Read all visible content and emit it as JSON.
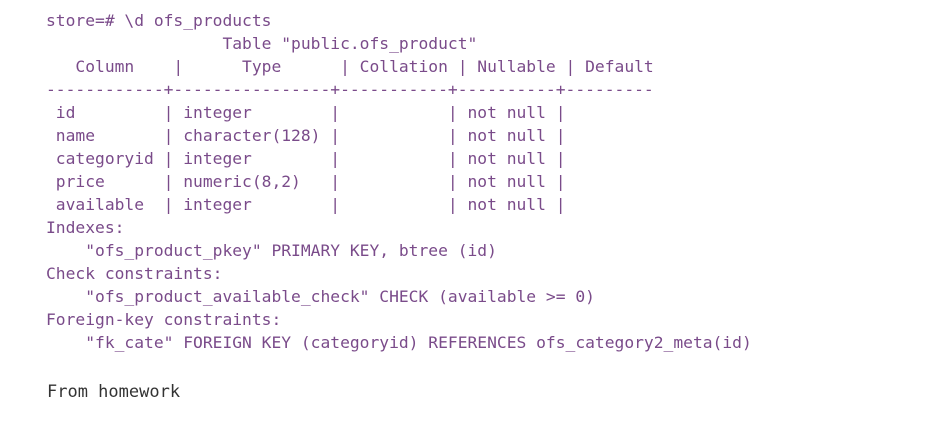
{
  "terminal": {
    "prompt": "store=# \\d ofs_products",
    "table_title": "                  Table \"public.ofs_product\"",
    "header": "   Column    |      Type      | Collation | Nullable | Default",
    "separator": "------------+----------------+-----------+----------+---------",
    "rows": [
      " id         | integer        |           | not null |",
      " name       | character(128) |           | not null |",
      " categoryid | integer        |           | not null |",
      " price      | numeric(8,2)   |           | not null |",
      " available  | integer        |           | not null |"
    ],
    "indexes_label": "Indexes:",
    "index_line": "    \"ofs_product_pkey\" PRIMARY KEY, btree (id)",
    "check_label": "Check constraints:",
    "check_line": "    \"ofs_product_available_check\" CHECK (available >= 0)",
    "fk_label": "Foreign-key constraints:",
    "fk_line": "    \"fk_cate\" FOREIGN KEY (categoryid) REFERENCES ofs_category2_meta(id)"
  },
  "caption": "From homework"
}
